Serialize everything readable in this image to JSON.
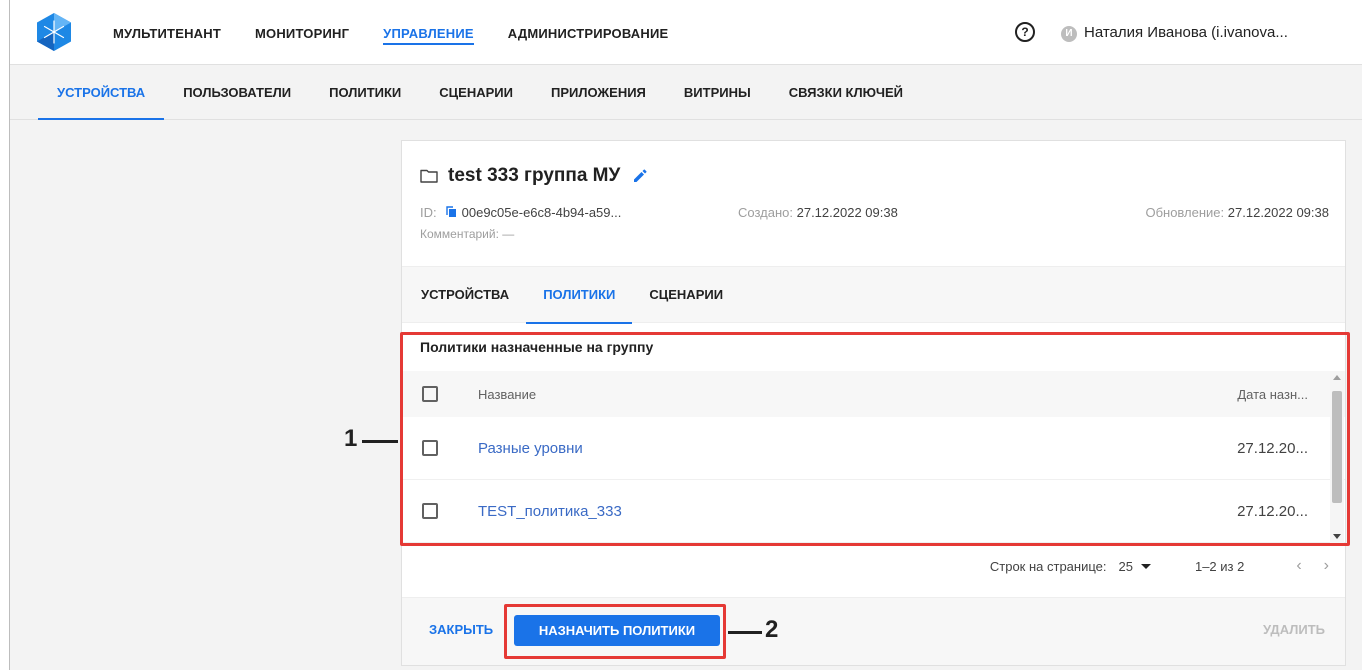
{
  "topnav": {
    "items": [
      "МУЛЬТИТЕНАНТ",
      "МОНИТОРИНГ",
      "УПРАВЛЕНИЕ",
      "АДМИНИСТРИРОВАНИЕ"
    ],
    "active_index": 2
  },
  "help_glyph": "?",
  "user": {
    "initial": "И",
    "name": "Наталия Иванова (i.ivanova..."
  },
  "subnav": {
    "items": [
      "УСТРОЙСТВА",
      "ПОЛЬЗОВАТЕЛИ",
      "ПОЛИТИКИ",
      "СЦЕНАРИИ",
      "ПРИЛОЖЕНИЯ",
      "ВИТРИНЫ",
      "СВЯЗКИ КЛЮЧЕЙ"
    ],
    "active_index": 0
  },
  "group": {
    "title": "test 333 группа МУ",
    "id_label": "ID:",
    "id_value": "00e9c05e-e6c8-4b94-a59...",
    "created_label": "Создано:",
    "created_value": "27.12.2022 09:38",
    "updated_label": "Обновление:",
    "updated_value": "27.12.2022 09:38",
    "comment": "Комментарий: —"
  },
  "tabs": {
    "items": [
      "УСТРОЙСТВА",
      "ПОЛИТИКИ",
      "СЦЕНАРИИ"
    ],
    "active_index": 1
  },
  "policies": {
    "section_title": "Политики назначенные на группу",
    "columns": [
      "Название",
      "Дата назн..."
    ],
    "rows": [
      {
        "name": "Разные уровни",
        "date": "27.12.20..."
      },
      {
        "name": "TEST_политика_333",
        "date": "27.12.20..."
      }
    ]
  },
  "pagination": {
    "rows_per_page_label": "Строк на странице:",
    "rows_per_page": "25",
    "range": "1–2 из 2",
    "prev": "‹",
    "next": "›"
  },
  "footer": {
    "close_label": "ЗАКРЫТЬ",
    "assign_label": "НАЗНАЧИТЬ ПОЛИТИКИ",
    "delete_label": "УДАЛИТЬ"
  },
  "annotations": {
    "callout_1": "1",
    "callout_2": "2"
  },
  "colors": {
    "accent": "#1a73e8",
    "link": "#3a6ac5",
    "highlight": "#e53935"
  }
}
